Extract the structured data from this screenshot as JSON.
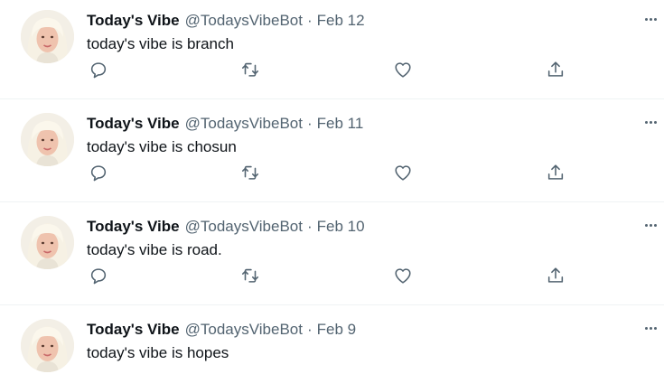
{
  "tweets": [
    {
      "display_name": "Today's Vibe",
      "handle": "@TodaysVibeBot",
      "separator": "·",
      "date": "Feb 12",
      "text": "today's vibe is branch"
    },
    {
      "display_name": "Today's Vibe",
      "handle": "@TodaysVibeBot",
      "separator": "·",
      "date": "Feb 11",
      "text": "today's vibe is chosun"
    },
    {
      "display_name": "Today's Vibe",
      "handle": "@TodaysVibeBot",
      "separator": "·",
      "date": "Feb 10",
      "text": "today's vibe is road."
    },
    {
      "display_name": "Today's Vibe",
      "handle": "@TodaysVibeBot",
      "separator": "·",
      "date": "Feb 9",
      "text": "today's vibe is hopes"
    }
  ],
  "icons": {
    "reply": "reply-icon",
    "retweet": "retweet-icon",
    "like": "like-icon",
    "share": "share-icon",
    "more": "more-icon"
  },
  "colors": {
    "text_primary": "#0f1419",
    "text_secondary": "#536471",
    "divider": "#eff3f4"
  }
}
